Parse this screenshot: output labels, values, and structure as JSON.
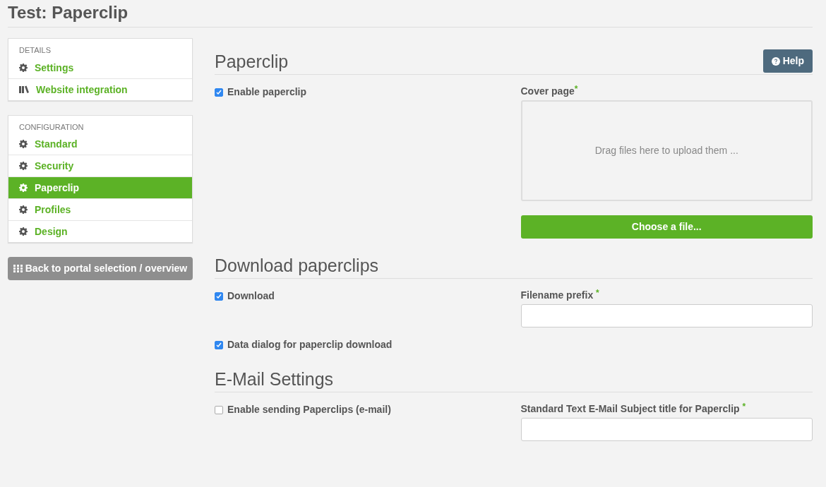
{
  "page_title": "Test: Paperclip",
  "sidebar": {
    "groups": [
      {
        "heading": "DETAILS",
        "items": [
          {
            "label": "Settings",
            "kind": "settings",
            "selected": false
          },
          {
            "label": "Website integration",
            "kind": "integration",
            "selected": false
          }
        ]
      },
      {
        "heading": "CONFIGURATION",
        "items": [
          {
            "label": "Standard",
            "kind": "settings",
            "selected": false
          },
          {
            "label": "Security",
            "kind": "settings",
            "selected": false
          },
          {
            "label": "Paperclip",
            "kind": "settings",
            "selected": true
          },
          {
            "label": "Profiles",
            "kind": "settings",
            "selected": false
          },
          {
            "label": "Design",
            "kind": "settings",
            "selected": false
          }
        ]
      }
    ],
    "back_button": "Back to portal selection / overview"
  },
  "sections": [
    {
      "title": "Paperclip",
      "help_button": "Help",
      "rows": [
        {
          "checkbox": {
            "label": "Enable paperclip",
            "checked": true
          },
          "field": {
            "kind": "upload",
            "label": "Cover page",
            "required_mark": "*",
            "dropzone": "Drag files here to upload them ...",
            "button": "Choose a file..."
          }
        }
      ]
    },
    {
      "title": "Download paperclips",
      "rows": [
        {
          "checkbox": {
            "label": "Download",
            "checked": true
          },
          "field": {
            "kind": "text",
            "label": "Filename prefix",
            "required_mark": "*"
          }
        },
        {
          "checkbox": {
            "label": "Data dialog for paperclip download",
            "checked": true
          }
        }
      ]
    },
    {
      "title": "E-Mail Settings",
      "rows": [
        {
          "checkbox": {
            "label": "Enable sending Paperclips (e-mail)",
            "checked": false
          },
          "field": {
            "kind": "text",
            "label": "Standard Text E-Mail Subject title for Paperclip",
            "required_mark": "*"
          }
        }
      ]
    }
  ]
}
